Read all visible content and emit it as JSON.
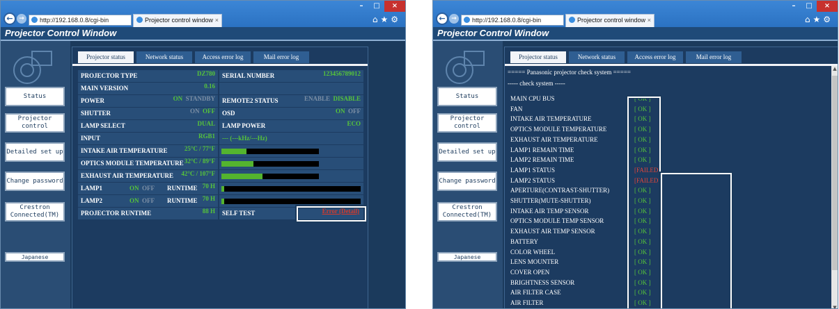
{
  "browser": {
    "url": "http://192.168.0.8/cgi-bin",
    "tab_title": "Projector control window",
    "tab_close": "×",
    "win_min": "–",
    "win_max": "□",
    "win_close": "×",
    "toolbar_icons": "⌂★⚙"
  },
  "app": {
    "title": "Projector Control Window"
  },
  "sidebar": {
    "status": "Status",
    "projector_control": "Projector control",
    "detailed_setup": "Detailed set up",
    "change_password": "Change password",
    "crestron": "Crestron Connected(TM)",
    "japanese": "Japanese"
  },
  "tabs": [
    "Projector status",
    "Network status",
    "Access error log",
    "Mail error log"
  ],
  "status": {
    "projector_type_label": "PROJECTOR TYPE",
    "projector_type": "DZ780",
    "serial_label": "SERIAL NUMBER",
    "serial": "123456789012",
    "main_version_label": "MAIN VERSION",
    "main_version": "0.16",
    "power_label": "POWER",
    "power_on": "ON",
    "power_standby": "STANDBY",
    "remote2_label": "REMOTE2 STATUS",
    "remote2_enable": "ENABLE",
    "remote2_disable": "DISABLE",
    "shutter_label": "SHUTTER",
    "shutter_on": "ON",
    "shutter_off": "OFF",
    "osd_label": "OSD",
    "osd_on": "ON",
    "osd_off": "OFF",
    "lamp_select_label": "LAMP SELECT",
    "lamp_select": "DUAL",
    "lamp_power_label": "LAMP POWER",
    "lamp_power": "ECO",
    "input_label": "INPUT",
    "input": "RGB1",
    "input_freq": "--- (---kHz/---Hz)",
    "intake_label": "INTAKE AIR TEMPERATURE",
    "intake": "25°C / 77°F",
    "intake_level": 0.26,
    "optics_label": "OPTICS MODULE TEMPERATURE",
    "optics": "32°C / 89°F",
    "optics_level": 0.33,
    "exhaust_label": "EXHAUST AIR TEMPERATURE",
    "exhaust": "42°C / 107°F",
    "exhaust_level": 0.42,
    "lamp1_label": "LAMP1",
    "lamp1_on": "ON",
    "lamp1_off": "OFF",
    "runtime_label": "RUNTIME",
    "lamp1_runtime": "70 H",
    "lamp1_level": 0.02,
    "lamp2_label": "LAMP2",
    "lamp2_on": "ON",
    "lamp2_off": "OFF",
    "lamp2_runtime": "70 H",
    "lamp2_level": 0.02,
    "projector_runtime_label": "PROJECTOR RUNTIME",
    "projector_runtime": "88 H",
    "self_test_label": "SELF TEST",
    "self_test": "Error (Detail)"
  },
  "check": {
    "header": "===== Panasonic projector check system =====",
    "subheader": "----- check system -----",
    "items": [
      {
        "name": "MAIN CPU BUS",
        "status": "[ OK ]"
      },
      {
        "name": "FAN",
        "status": "[ OK ]"
      },
      {
        "name": "INTAKE AIR TEMPERATURE",
        "status": "[ OK ]"
      },
      {
        "name": "OPTICS MODULE TEMPERATURE",
        "status": "[ OK ]"
      },
      {
        "name": "EXHAUST AIR TEMPERATURE",
        "status": "[ OK ]"
      },
      {
        "name": "LAMP1 REMAIN TIME",
        "status": "[ OK ]"
      },
      {
        "name": "LAMP2 REMAIN TIME",
        "status": "[ OK ]"
      },
      {
        "name": "LAMP1 STATUS",
        "status": "[FAILED]"
      },
      {
        "name": "LAMP2 STATUS",
        "status": "[FAILED]"
      },
      {
        "name": "APERTURE(CONTRAST-SHUTTER)",
        "status": "[ OK ]"
      },
      {
        "name": "SHUTTER(MUTE-SHUTTER)",
        "status": "[ OK ]"
      },
      {
        "name": "INTAKE AIR TEMP SENSOR",
        "status": "[ OK ]"
      },
      {
        "name": "OPTICS MODULE TEMP SENSOR",
        "status": "[ OK ]"
      },
      {
        "name": "EXHAUST AIR TEMP SENSOR",
        "status": "[ OK ]"
      },
      {
        "name": "BATTERY",
        "status": "[ OK ]"
      },
      {
        "name": "COLOR WHEEL",
        "status": "[ OK ]"
      },
      {
        "name": "LENS MOUNTER",
        "status": "[ OK ]"
      },
      {
        "name": "COVER OPEN",
        "status": "[ OK ]"
      },
      {
        "name": "BRIGHTNESS SENSOR",
        "status": "[ OK ]"
      },
      {
        "name": "AIR FILTER CASE",
        "status": "[ OK ]"
      },
      {
        "name": "AIR FILTER",
        "status": "[ OK ]"
      }
    ]
  },
  "colors": {
    "ok": "#56c43a",
    "failed": "#e0463a",
    "panel": "#1c3b60",
    "title": "#1f4a78"
  }
}
